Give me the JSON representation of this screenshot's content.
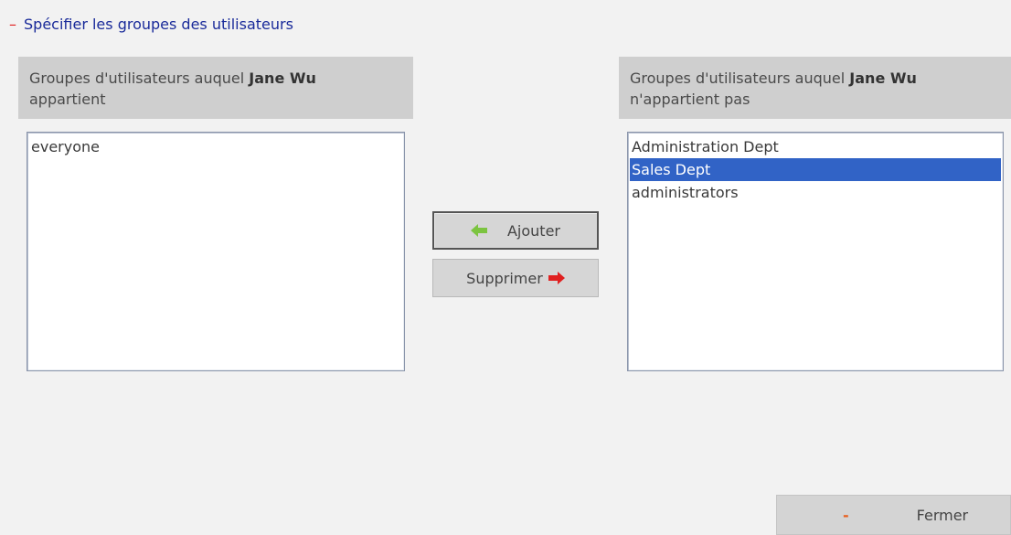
{
  "section": {
    "toggle_symbol": "–",
    "title": "Spécifier les groupes des utilisateurs"
  },
  "left_panel": {
    "header_prefix": "Groupes d'utilisateurs auquel ",
    "user_name": "Jane Wu",
    "header_suffix": "appartient",
    "items": [
      {
        "label": "everyone",
        "selected": false
      }
    ]
  },
  "right_panel": {
    "header_prefix": "Groupes d'utilisateurs auquel ",
    "user_name": "Jane Wu",
    "header_suffix": "n'appartient pas",
    "items": [
      {
        "label": "Administration Dept",
        "selected": false
      },
      {
        "label": "Sales Dept",
        "selected": true
      },
      {
        "label": "administrators",
        "selected": false
      }
    ]
  },
  "actions": {
    "add_label": "Ajouter",
    "add_icon": "green-left-arrow-icon",
    "remove_label": "Supprimer",
    "remove_icon": "red-right-arrow-icon"
  },
  "footer": {
    "close_symbol": "-",
    "close_label": "Fermer"
  },
  "colors": {
    "title": "#1a2b9a",
    "selection": "#3163c6",
    "add_arrow": "#7cc440",
    "remove_arrow": "#e02020",
    "close_symbol": "#e86020"
  }
}
